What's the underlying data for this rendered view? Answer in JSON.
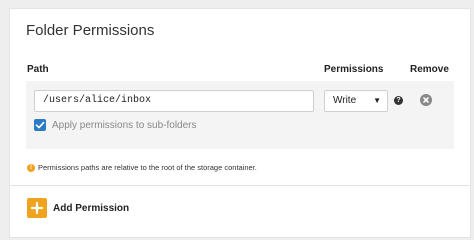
{
  "panel": {
    "title": "Folder Permissions",
    "columns": {
      "path": "Path",
      "permissions": "Permissions",
      "remove": "Remove"
    }
  },
  "rows": [
    {
      "path_value": "/users/alice/inbox",
      "permission_selected": "Write",
      "help_glyph": "?",
      "apply_subfolders_checked": true,
      "apply_subfolders_label": "Apply permissions to sub-folders"
    }
  ],
  "info": {
    "icon_glyph": "!",
    "text": "Permissions paths are relative to the root of the storage container."
  },
  "add": {
    "label": "Add Permission"
  },
  "colors": {
    "accent_orange": "#f0a31e",
    "checkbox_blue": "#2d7bc4",
    "remove_gray": "#888888",
    "row_bg": "#f4f4f4"
  },
  "icons": {
    "help": "question-circle-icon",
    "remove": "close-circle-icon",
    "checkbox": "checkmark-icon",
    "info": "info-circle-icon",
    "add": "plus-icon",
    "select": "caret-down-icon"
  }
}
